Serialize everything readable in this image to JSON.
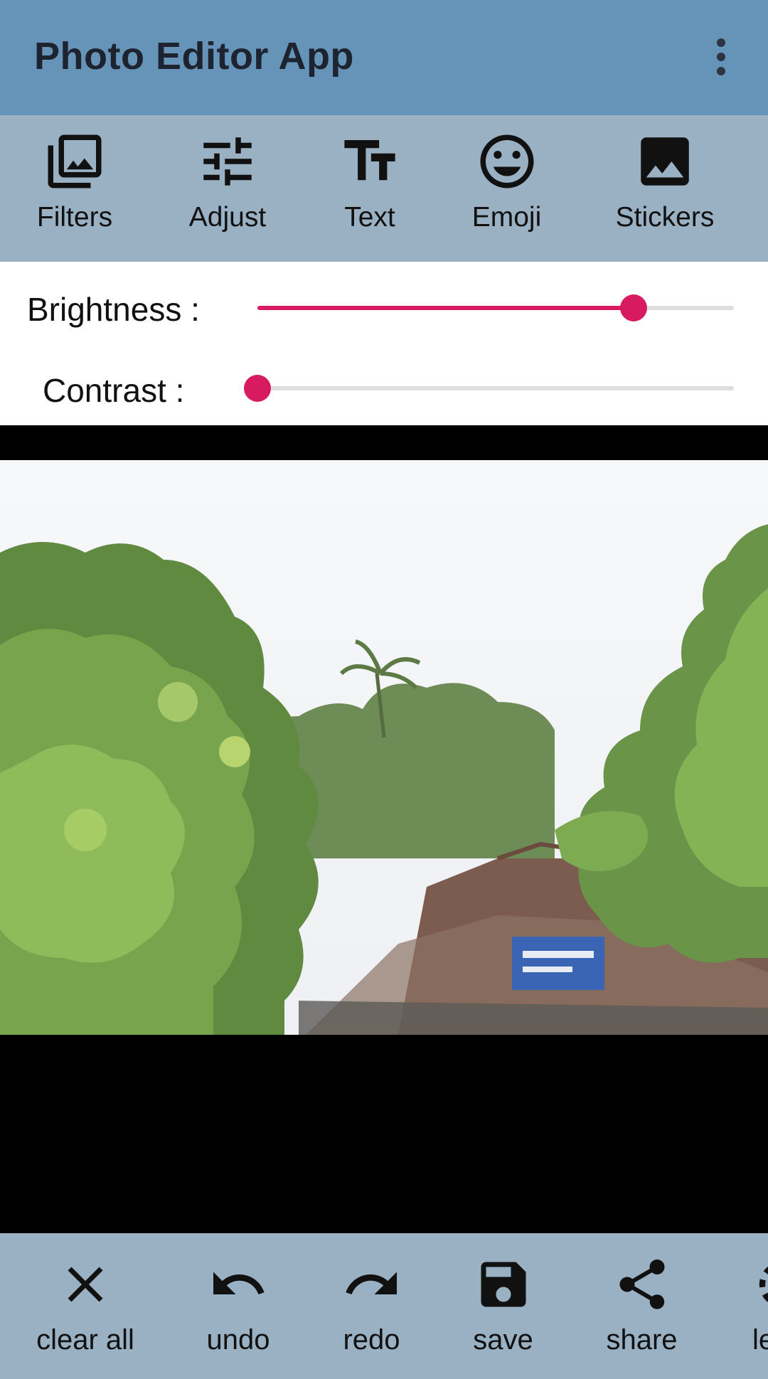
{
  "appbar": {
    "title": "Photo Editor App",
    "menu_icon": "more-vert-icon"
  },
  "tools": [
    {
      "label": "Filters",
      "icon": "photo-library-icon"
    },
    {
      "label": "Adjust",
      "icon": "tune-icon"
    },
    {
      "label": "Text",
      "icon": "text-fields-icon"
    },
    {
      "label": "Emoji",
      "icon": "smiley-icon"
    },
    {
      "label": "Stickers",
      "icon": "image-icon"
    }
  ],
  "adjustments": {
    "brightness": {
      "label": "Brightness :",
      "value": 0.79
    },
    "contrast": {
      "label": "Contrast :",
      "value": 0.0
    }
  },
  "accent_color": "#d81b60",
  "appbar_color": "#6694b8",
  "toolbar_color": "#9ab1c4",
  "actions": [
    {
      "label": "clear all",
      "icon": "close-icon"
    },
    {
      "label": "undo",
      "icon": "undo-icon"
    },
    {
      "label": "redo",
      "icon": "redo-icon"
    },
    {
      "label": "save",
      "icon": "save-icon"
    },
    {
      "label": "share",
      "icon": "share-icon"
    },
    {
      "label": "le",
      "icon": "loading-icon"
    }
  ]
}
